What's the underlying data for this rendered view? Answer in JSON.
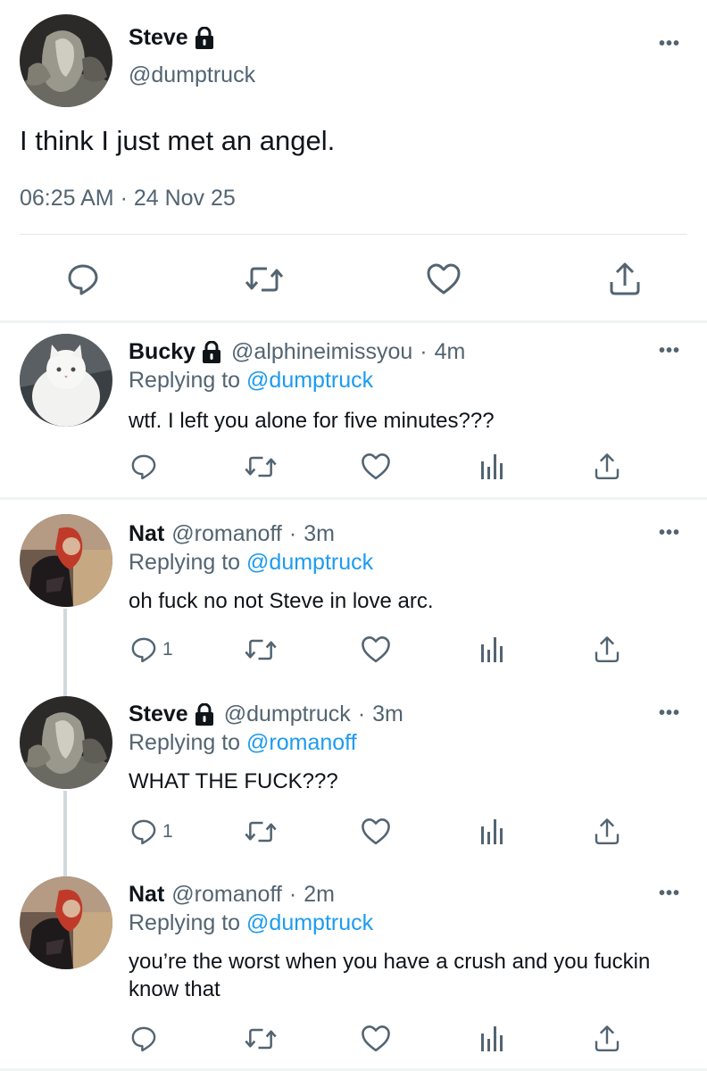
{
  "main": {
    "name": "Steve",
    "handle": "@dumptruck",
    "text": "I think I just met an angel.",
    "meta": "06:25 AM · 24 Nov 25",
    "more": "•••"
  },
  "replies": [
    {
      "name": "Bucky",
      "handle": "@alphineimissyou",
      "time": "4m",
      "replying_label": "Replying to",
      "mention": "@dumptruck",
      "text": "wtf. I left you alone for five minutes???",
      "reply_count": "",
      "more": "•••"
    },
    {
      "name": "Nat",
      "handle": "@romanoff",
      "time": "3m",
      "replying_label": "Replying to",
      "mention": "@dumptruck",
      "text": "oh fuck no not Steve in love arc.",
      "reply_count": "1",
      "more": "•••"
    },
    {
      "name": "Steve",
      "handle": "@dumptruck",
      "time": "3m",
      "replying_label": "Replying to",
      "mention": "@romanoff",
      "text": "WHAT THE FUCK???",
      "reply_count": "1",
      "more": "•••"
    },
    {
      "name": "Nat",
      "handle": "@romanoff",
      "time": "2m",
      "replying_label": "Replying to",
      "mention": "@dumptruck",
      "text": "you’re the worst when you have a crush and you fuckin know that",
      "reply_count": "",
      "more": "•••"
    }
  ],
  "icons": {
    "reply": "speech-bubble-icon",
    "retweet": "retweet-icon",
    "like": "heart-icon",
    "views": "bar-chart-icon",
    "share": "share-icon",
    "lock": "lock-icon"
  },
  "colors": {
    "accent": "#1d9bf0",
    "text": "#0f1419",
    "secondary": "#536471"
  }
}
